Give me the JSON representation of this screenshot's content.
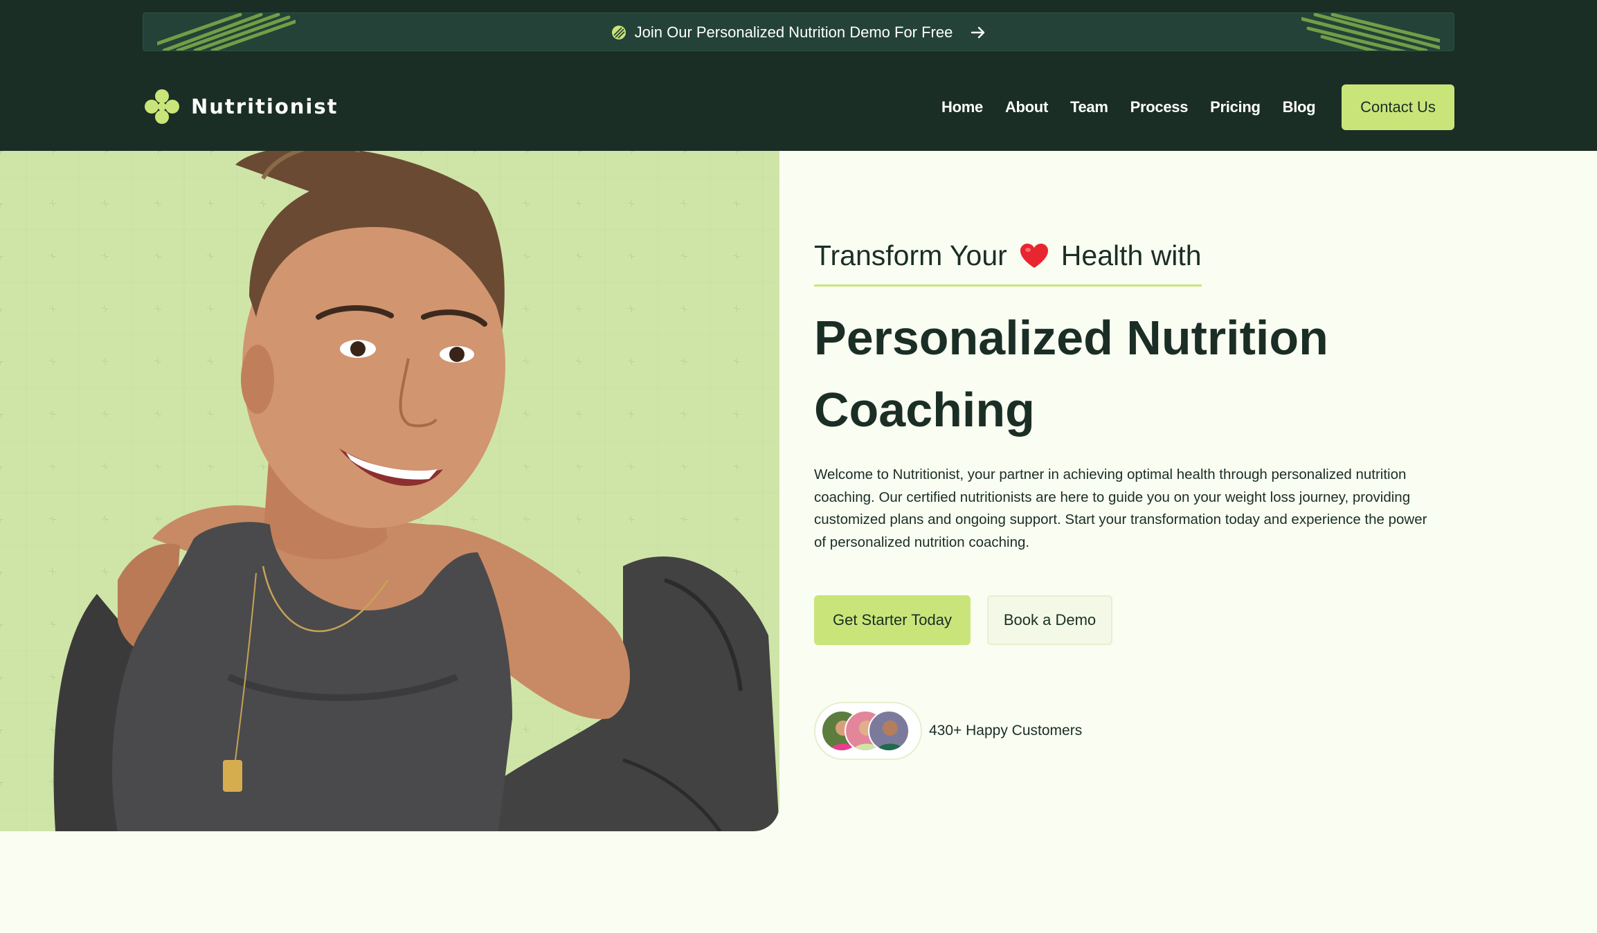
{
  "promo": {
    "text": "Join Our Personalized Nutrition Demo For Free",
    "icon": "leaf-ball-icon",
    "arrow_icon": "arrow-right-icon"
  },
  "brand": {
    "name": "Nutritionist",
    "icon": "clover-logo-icon"
  },
  "nav": {
    "items": [
      "Home",
      "About",
      "Team",
      "Process",
      "Pricing",
      "Blog"
    ],
    "cta": "Contact Us"
  },
  "hero": {
    "eyebrow_before": "Transform Your",
    "eyebrow_icon": "heart-icon",
    "eyebrow_after": "Health with",
    "headline": "Personalized Nutrition Coaching",
    "description": "Welcome to Nutritionist, your partner in achieving optimal health through personalized nutrition coaching. Our certified nutritionists are here to guide you on your weight loss journey, providing customized plans and ongoing support. Start your transformation today and experience the power of personalized nutrition coaching.",
    "primary_button": "Get Starter Today",
    "secondary_button": "Book a Demo",
    "customers_label": "430+ Happy Customers"
  },
  "colors": {
    "header_bg": "#1a2e25",
    "accent": "#c9e57a",
    "page_bg": "#fafdf2",
    "hero_image_bg": "#cfe5a8",
    "text": "#1a2e25"
  }
}
